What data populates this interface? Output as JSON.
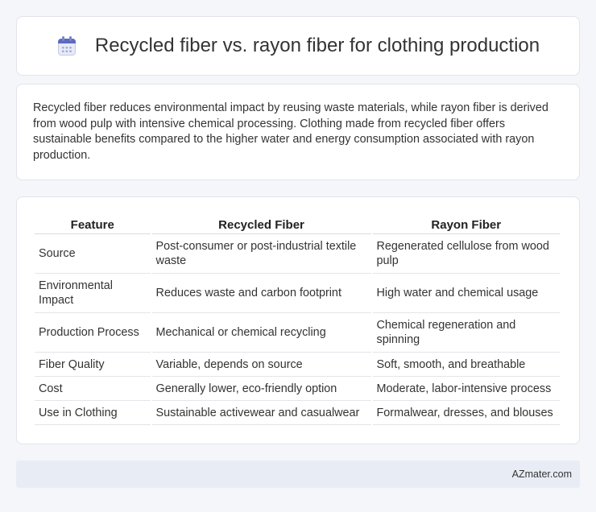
{
  "header": {
    "title": "Recycled fiber vs. rayon fiber for clothing production",
    "icon": "calendar-icon"
  },
  "description": "Recycled fiber reduces environmental impact by reusing waste materials, while rayon fiber is derived from wood pulp with intensive chemical processing. Clothing made from recycled fiber offers sustainable benefits compared to the higher water and energy consumption associated with rayon production.",
  "table": {
    "headers": [
      "Feature",
      "Recycled Fiber",
      "Rayon Fiber"
    ],
    "rows": [
      [
        "Source",
        "Post-consumer or post-industrial textile waste",
        "Regenerated cellulose from wood pulp"
      ],
      [
        "Environmental Impact",
        "Reduces waste and carbon footprint",
        "High water and chemical usage"
      ],
      [
        "Production Process",
        "Mechanical or chemical recycling",
        "Chemical regeneration and spinning"
      ],
      [
        "Fiber Quality",
        "Variable, depends on source",
        "Soft, smooth, and breathable"
      ],
      [
        "Cost",
        "Generally lower, eco-friendly option",
        "Moderate, labor-intensive process"
      ],
      [
        "Use in Clothing",
        "Sustainable activewear and casualwear",
        "Formalwear, dresses, and blouses"
      ]
    ]
  },
  "footer": {
    "site": "AZmater.com"
  }
}
